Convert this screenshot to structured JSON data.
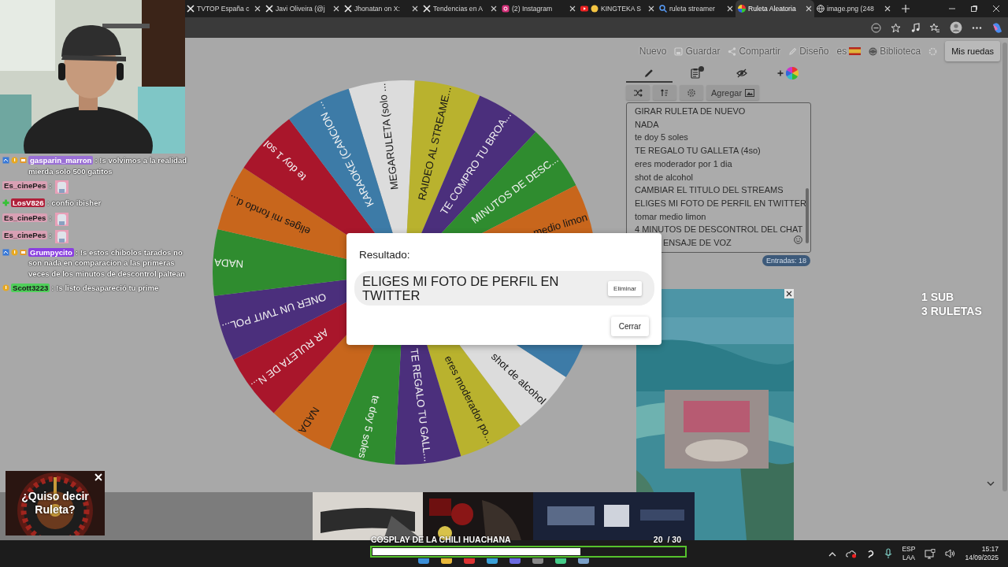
{
  "browser": {
    "tabs": [
      {
        "title": "TVTOP España c",
        "kind": "x",
        "selected": false
      },
      {
        "title": "Javi Oliveira (@j",
        "kind": "x",
        "selected": false
      },
      {
        "title": "Jhonatan on X:",
        "kind": "x",
        "selected": false
      },
      {
        "title": "Tendencias en A",
        "kind": "x",
        "selected": false
      },
      {
        "title": "(2) Instagram",
        "kind": "instagram",
        "selected": false
      },
      {
        "title": "KINGTEKA S",
        "kind": "youtube",
        "selected": false
      },
      {
        "title": "ruleta streamer",
        "kind": "search",
        "selected": false
      },
      {
        "title": "Ruleta Aleatoria",
        "kind": "wheel",
        "selected": true
      },
      {
        "title": "image.png (248",
        "kind": "globe",
        "selected": false
      }
    ]
  },
  "app_toolbar": {
    "items": [
      {
        "label": "Nuevo",
        "kind": "plain"
      },
      {
        "label": "Guardar",
        "kind": "save"
      },
      {
        "label": "Compartir",
        "kind": "share"
      },
      {
        "label": "Diseño",
        "kind": "pencil"
      },
      {
        "label": "es",
        "kind": "flag"
      },
      {
        "label": "Biblioteca",
        "kind": "library"
      }
    ],
    "button": "Mis ruedas"
  },
  "wheel": {
    "segments": [
      {
        "label": "MEGARULETA (solo ...",
        "color": "#dcdcdc"
      },
      {
        "label": "RAIDEO AL STREAME...",
        "color": "#b9b22e"
      },
      {
        "label": "TE COMPRO TU BROA...",
        "color": "#4b2f7c"
      },
      {
        "label": "MINUTOS DE DESC...",
        "color": "#2f8c2f"
      },
      {
        "label": "medio limon",
        "color": "#c8661c"
      },
      {
        "color": "#3d7ba7"
      },
      {
        "label": "shot de alcohol",
        "color": "#dcdcdc"
      },
      {
        "label": "eres moderador po...",
        "color": "#b9b22e"
      },
      {
        "label": "TE REGALO TU GALL...",
        "color": "#4b2f7c"
      },
      {
        "label": "te doy 5 soles",
        "color": "#2f8c2f"
      },
      {
        "label": "NADA",
        "color": "#c8661c"
      },
      {
        "label": "AR RULETA DE N...",
        "color": "#a9162b"
      },
      {
        "label": "ONER UN TWIT POL...",
        "color": "#4b2f7c"
      },
      {
        "label": "NADA",
        "color": "#2f8c2f"
      },
      {
        "label": "eliges mi fondo d...",
        "color": "#c8661c"
      },
      {
        "label": "te doy 1 sol",
        "color": "#a9162b"
      },
      {
        "label": "KARAOKE (CANCION ...",
        "color": "#3d7ba7"
      }
    ]
  },
  "editor": {
    "tabs": [
      {
        "kind": "pencil",
        "selected": true
      },
      {
        "kind": "clipboard",
        "selected": false
      },
      {
        "kind": "eye-off",
        "selected": false
      },
      {
        "kind": "palette",
        "selected": false
      }
    ],
    "actions": [
      {
        "kind": "shuffle"
      },
      {
        "kind": "sort"
      },
      {
        "kind": "settings"
      },
      {
        "kind": "add-image",
        "label": "Agregar"
      }
    ],
    "entries": [
      {
        "text": "GIRAR RULETA DE NUEVO",
        "covered": false
      },
      {
        "text": "NADA",
        "covered": false
      },
      {
        "text": "te doy 5 soles",
        "covered": false
      },
      {
        "text": "TE REGALO TU GALLETA (4so)",
        "covered": false
      },
      {
        "text": "eres moderador por 1 dia",
        "covered": false
      },
      {
        "text": "shot de alcohol",
        "covered": false
      },
      {
        "text": "CAMBIAR EL TITULO DEL STREAMS",
        "covered": false
      },
      {
        "text": "ELIGES MI FOTO DE PERFIL EN TWITTER",
        "covered": false
      },
      {
        "text": "tomar medio limon",
        "covered": false
      },
      {
        "text": "4 MINUTOS DE DESCONTROL DEL CHAT",
        "covered": false
      },
      {
        "text": "ENSAJE DE VOZ",
        "covered": true
      }
    ],
    "count_badge": "Entradas: 18"
  },
  "dialog": {
    "heading": "Resultado:",
    "result": "ELIGES MI FOTO DE PERFIL EN TWITTER",
    "remove_button": "Eliminar",
    "close_button": "Cerrar"
  },
  "chat": {
    "messages": [
      {
        "user": "gasparin_marron",
        "color": "#9a6fd6",
        "badges": [
          {
            "kind": "prediction"
          },
          {
            "kind": "bits"
          },
          {
            "kind": "sub"
          }
        ],
        "kind": "text",
        "text": ": !s volvimos a la realidad mierda solo 500 gatitos"
      },
      {
        "user": "Es_cinePes",
        "color": "#d9a0b4",
        "kind": "emote",
        "text": ":"
      },
      {
        "user": "LosV826",
        "color": "#b0203a",
        "badges": [
          {
            "kind": "plus"
          }
        ],
        "kind": "text",
        "text": ": confio ibisher"
      },
      {
        "user": "Es_cinePes",
        "color": "#d9a0b4",
        "kind": "emote",
        "text": ":"
      },
      {
        "user": "Es_cinePes",
        "color": "#d9a0b4",
        "kind": "emote",
        "text": ":"
      },
      {
        "user": "Grumpycito",
        "color": "#8a3fe0",
        "badges": [
          {
            "kind": "prediction"
          },
          {
            "kind": "bits"
          },
          {
            "kind": "sub"
          }
        ],
        "kind": "text",
        "text": ": !s estos chibolos tarados no son nada en comparacion a las primeras veces de los minutos de descontrol paltean"
      },
      {
        "user": "Scott3223",
        "color": "#4fcf5a",
        "badges": [
          {
            "kind": "bits"
          }
        ],
        "kind": "text",
        "text": ": !s listo desapareció tu prime"
      }
    ]
  },
  "overlays": {
    "sub_goal": [
      "1 SUB",
      "3 RULETAS"
    ],
    "suggestion": "¿Quiso decir Ruleta?",
    "goal": {
      "title": "COSPLAY DE LA CHILI HUACHANA",
      "count": "20",
      "total": "/ 30",
      "level": 0.667
    }
  },
  "taskbar": {
    "language": [
      "ESP",
      "LAA"
    ],
    "time": "15:17",
    "date": "14/09/2025"
  }
}
